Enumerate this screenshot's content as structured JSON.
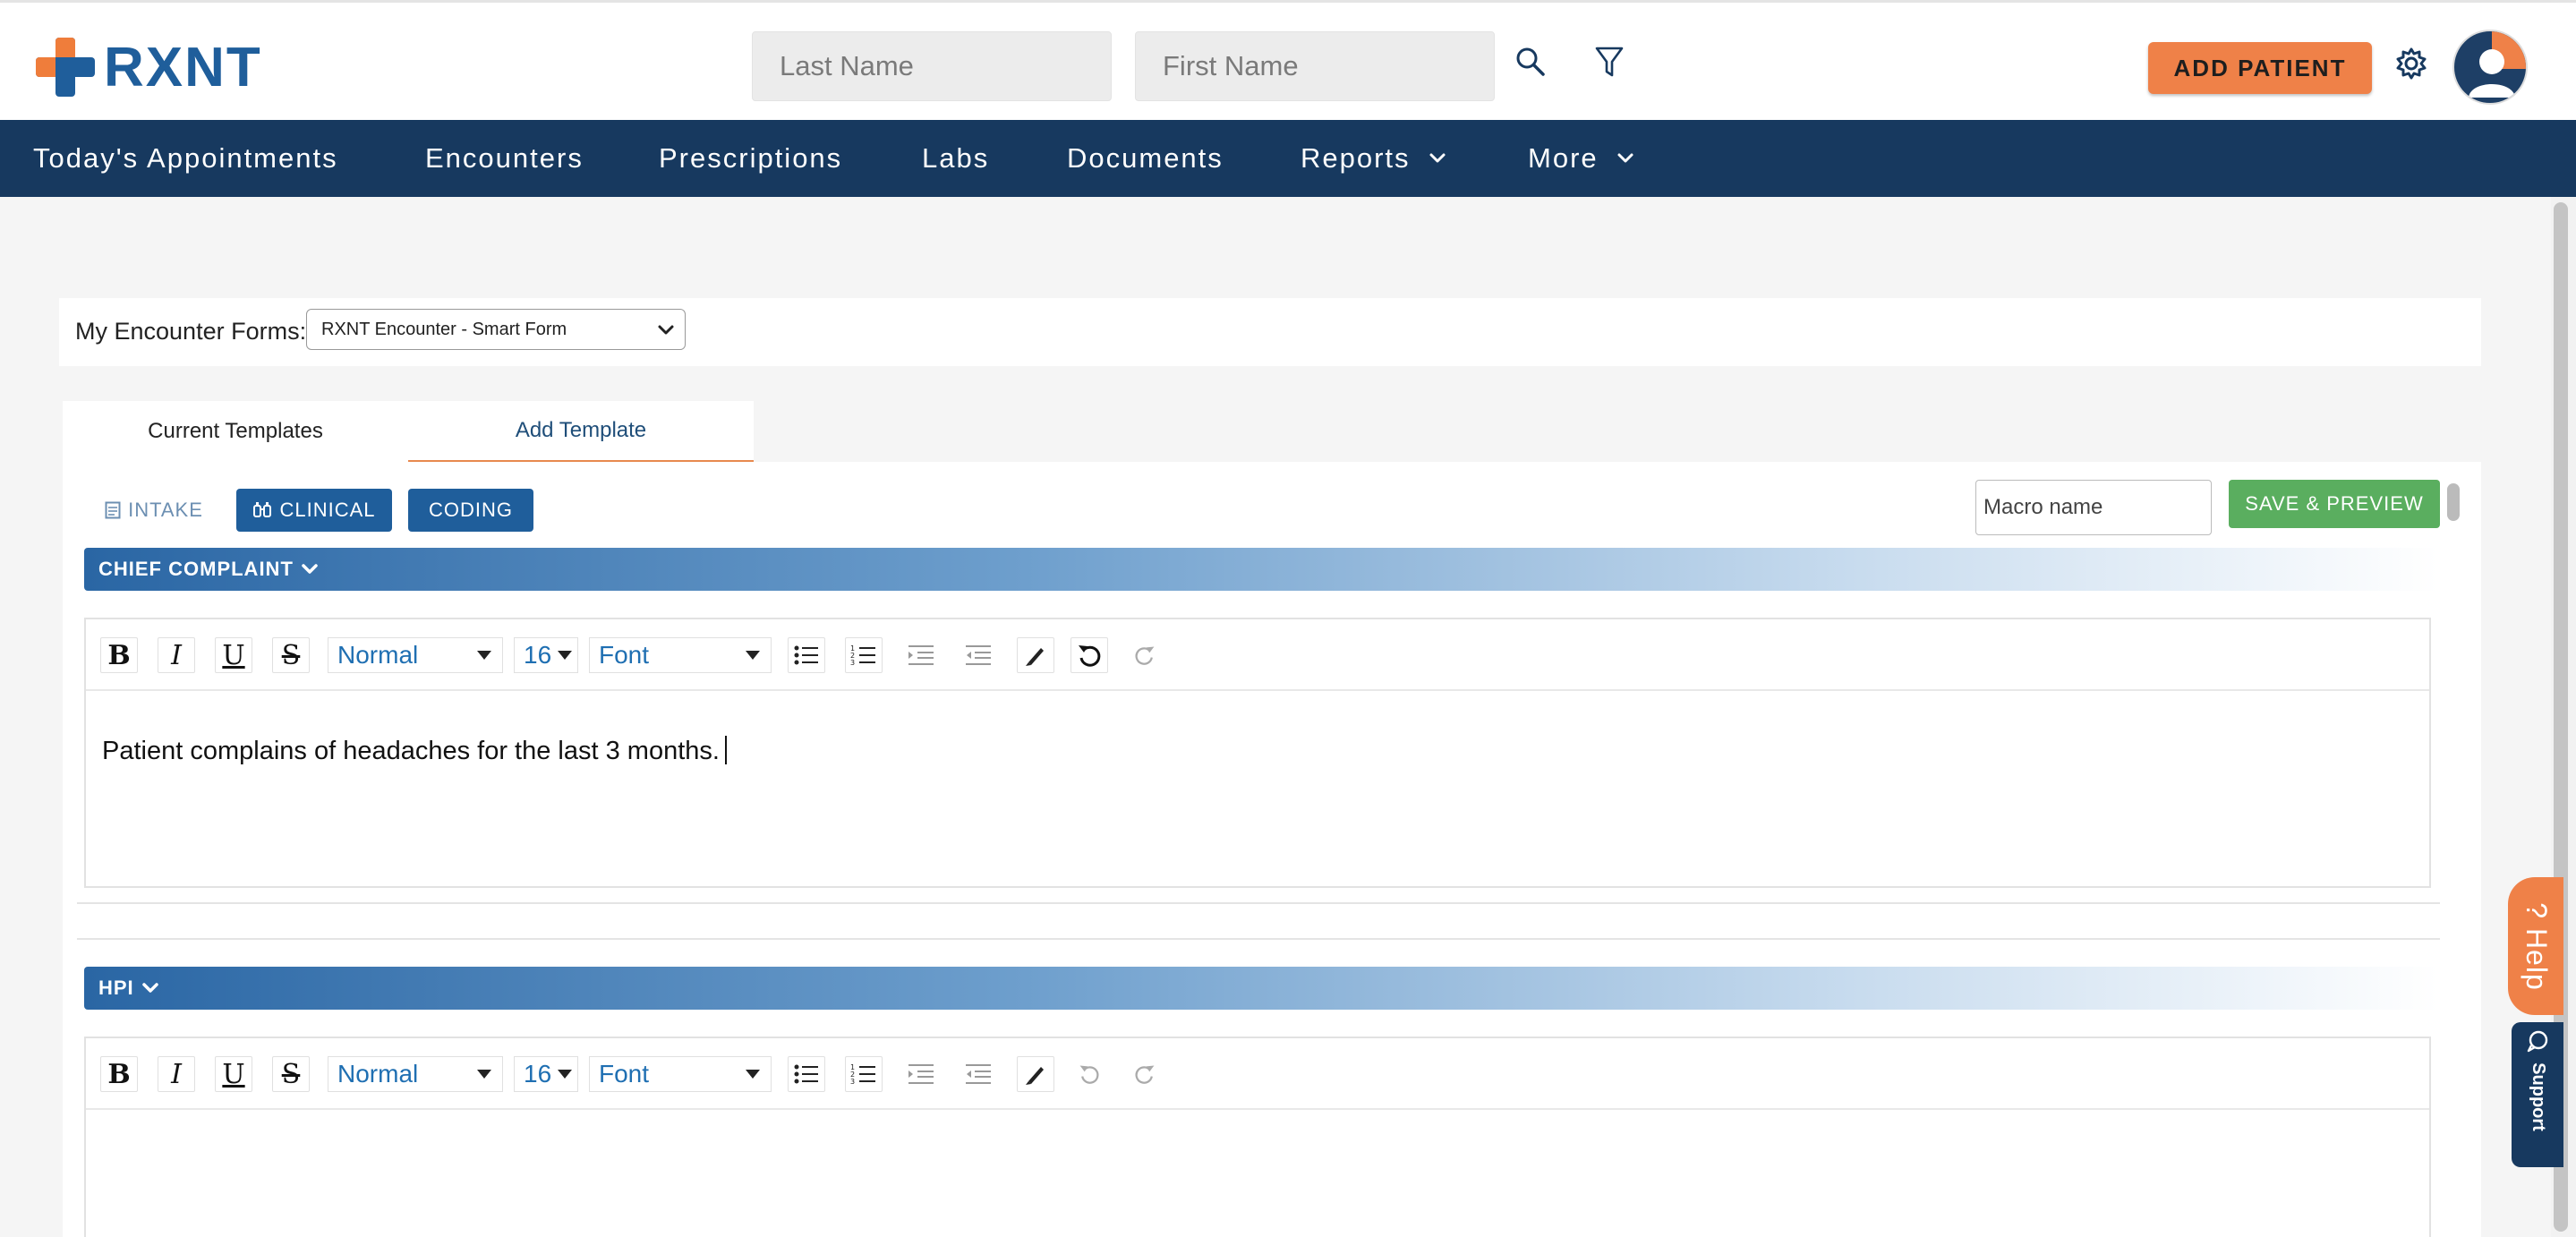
{
  "header": {
    "logo_text": "RXNT",
    "last_name_placeholder": "Last Name",
    "first_name_placeholder": "First Name",
    "add_patient_label": "ADD PATIENT",
    "brand_orange": "#ef8148",
    "brand_navy": "#17395f"
  },
  "nav": {
    "items": [
      {
        "label": "Today's Appointments",
        "has_dropdown": false
      },
      {
        "label": "Encounters",
        "has_dropdown": false
      },
      {
        "label": "Prescriptions",
        "has_dropdown": false
      },
      {
        "label": "Labs",
        "has_dropdown": false
      },
      {
        "label": "Documents",
        "has_dropdown": false
      },
      {
        "label": "Reports",
        "has_dropdown": true
      },
      {
        "label": "More",
        "has_dropdown": true
      }
    ]
  },
  "encounter_forms": {
    "label": "My Encounter Forms:",
    "selected": "RXNT Encounter - Smart Form"
  },
  "tabs": [
    {
      "label": "Current Templates",
      "active": false
    },
    {
      "label": "Add Template",
      "active": true
    }
  ],
  "template_types": {
    "intake": "INTAKE",
    "clinical": "CLINICAL",
    "coding": "CODING"
  },
  "macro_name_placeholder": "Macro name",
  "save_preview_label": "SAVE & PREVIEW",
  "editor_toolbar": {
    "style": "Normal",
    "size": "16",
    "font": "Font"
  },
  "sections": [
    {
      "title": "CHIEF COMPLAINT",
      "content": "Patient complains of headaches for the last 3 months."
    },
    {
      "title": "HPI",
      "content": ""
    }
  ],
  "side_tabs": {
    "help": "? Help",
    "support": "Support"
  }
}
